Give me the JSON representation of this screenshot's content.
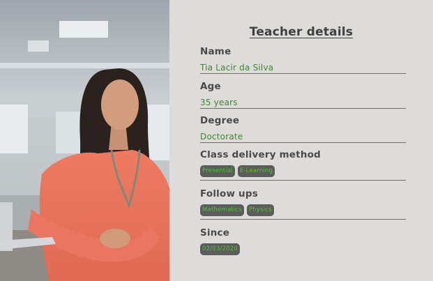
{
  "photo": {
    "subject": "teacher-portrait"
  },
  "details": {
    "title": "Teacher details",
    "name": {
      "label": "Name",
      "value": "Tia Lacir da Silva"
    },
    "age": {
      "label": "Age",
      "value": "35 years"
    },
    "degree": {
      "label": "Degree",
      "value": "Doctorate"
    },
    "class_delivery": {
      "label": "Class delivery method",
      "chips": [
        "Presential",
        "E-Learning"
      ]
    },
    "follow_ups": {
      "label": "Follow ups",
      "chips": [
        "Mathematics",
        "Physics"
      ]
    },
    "since": {
      "label": "Since",
      "chips": [
        "02/03/2020"
      ]
    }
  },
  "colors": {
    "panel_bg": "#dddcdb",
    "value_green": "#3d8a2e",
    "chip_bg": "#5b5b5b",
    "chip_text": "#56c23f"
  }
}
